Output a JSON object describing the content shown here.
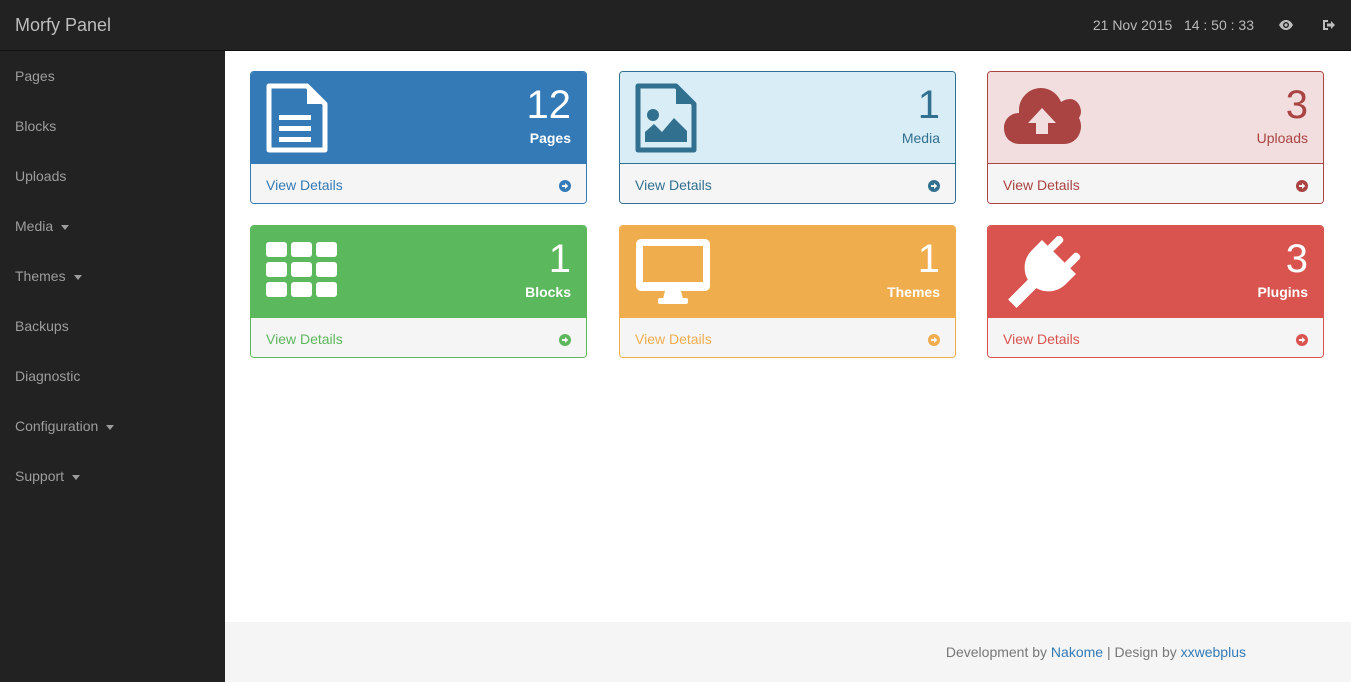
{
  "topbar": {
    "brand": "Morfy Panel",
    "date": "21 Nov 2015",
    "time": "14 : 50 : 33",
    "icons": [
      "eye-icon",
      "sign-out-icon"
    ]
  },
  "sidebar": {
    "items": [
      {
        "label": "Pages",
        "dropdown": false
      },
      {
        "label": "Blocks",
        "dropdown": false
      },
      {
        "label": "Uploads",
        "dropdown": false
      },
      {
        "label": "Media",
        "dropdown": true
      },
      {
        "label": "Themes",
        "dropdown": true
      },
      {
        "label": "Backups",
        "dropdown": false
      },
      {
        "label": "Diagnostic",
        "dropdown": false
      },
      {
        "label": "Configuration",
        "dropdown": true
      },
      {
        "label": "Support",
        "dropdown": true
      }
    ]
  },
  "panels": [
    {
      "count": "12",
      "label": "Pages",
      "details": "View Details",
      "icon": "file-text-icon",
      "accent": "#337ab7",
      "head_bg": "#337ab7",
      "head_color": "#ffffff"
    },
    {
      "count": "1",
      "label": "Media",
      "details": "View Details",
      "icon": "file-image-icon",
      "accent": "#31708f",
      "head_bg": "#d9edf7",
      "head_color": "#31708f"
    },
    {
      "count": "3",
      "label": "Uploads",
      "details": "View Details",
      "icon": "cloud-upload-icon",
      "accent": "#a94442",
      "head_bg": "#f2dede",
      "head_color": "#a94442"
    },
    {
      "count": "1",
      "label": "Blocks",
      "details": "View Details",
      "icon": "grid-icon",
      "accent": "#5cb85c",
      "head_bg": "#5cb85c",
      "head_color": "#ffffff"
    },
    {
      "count": "1",
      "label": "Themes",
      "details": "View Details",
      "icon": "desktop-icon",
      "accent": "#f0ad4e",
      "head_bg": "#f0ad4e",
      "head_color": "#ffffff"
    },
    {
      "count": "3",
      "label": "Plugins",
      "details": "View Details",
      "icon": "plug-icon",
      "accent": "#d9534f",
      "head_bg": "#d9534f",
      "head_color": "#ffffff"
    }
  ],
  "footer": {
    "prefix": "Development by ",
    "dev_link": "Nakome",
    "separator": " | Design by ",
    "design_link": "xxwebplus"
  }
}
